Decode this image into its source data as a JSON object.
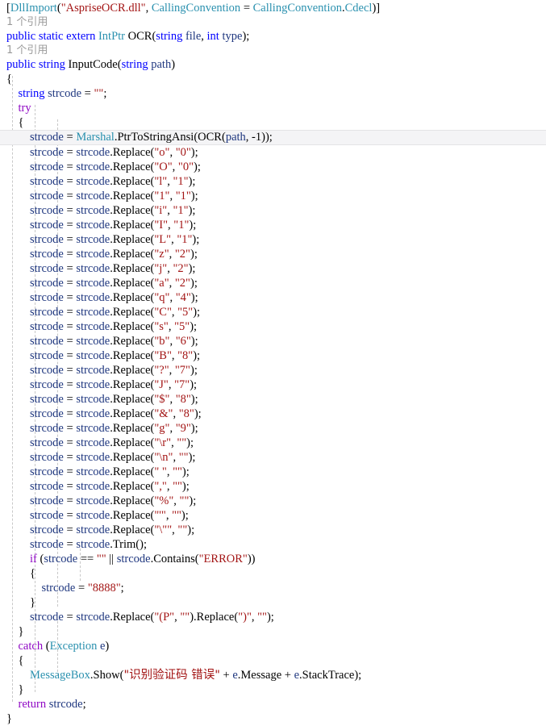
{
  "editor": {
    "language": "csharp",
    "background": "#ffffff",
    "current_line_background": "#f4f4f6",
    "colors": {
      "keyword": "#0000ff",
      "control_keyword": "#8f08c4",
      "type": "#2b91af",
      "string": "#a31515",
      "variable": "#1f377f",
      "plain": "#000000",
      "codelens": "#9a9a9a",
      "indent_guide": "#c8c8c8"
    },
    "codelens_label": "1 个引用",
    "lines": [
      {
        "id": "l1",
        "kind": "code",
        "text": "[DllImport(\"AspriseOCR.dll\", CallingConvention = CallingConvention.Cdecl)]"
      },
      {
        "id": "l2",
        "kind": "codelens",
        "text": "1 个引用"
      },
      {
        "id": "l3",
        "kind": "code",
        "text": "public static extern IntPtr OCR(string file, int type);"
      },
      {
        "id": "l4",
        "kind": "codelens",
        "text": "1 个引用"
      },
      {
        "id": "l5",
        "kind": "code",
        "text": "public string InputCode(string path)"
      },
      {
        "id": "l6",
        "kind": "code",
        "text": "{"
      },
      {
        "id": "l7",
        "kind": "code",
        "text": "    string strcode = \"\";"
      },
      {
        "id": "l8",
        "kind": "code",
        "text": "    try"
      },
      {
        "id": "l9",
        "kind": "code",
        "text": "    {"
      },
      {
        "id": "l10",
        "kind": "code",
        "current": true,
        "text": "        strcode = Marshal.PtrToStringAnsi(OCR(path, -1));"
      },
      {
        "id": "l11",
        "kind": "code",
        "text": "        strcode = strcode.Replace(\"o\", \"0\");"
      },
      {
        "id": "l12",
        "kind": "code",
        "text": "        strcode = strcode.Replace(\"O\", \"0\");"
      },
      {
        "id": "l13",
        "kind": "code",
        "text": "        strcode = strcode.Replace(\"l\", \"1\");"
      },
      {
        "id": "l14",
        "kind": "code",
        "text": "        strcode = strcode.Replace(\"1\", \"1\");"
      },
      {
        "id": "l15",
        "kind": "code",
        "text": "        strcode = strcode.Replace(\"i\", \"1\");"
      },
      {
        "id": "l16",
        "kind": "code",
        "text": "        strcode = strcode.Replace(\"I\", \"1\");"
      },
      {
        "id": "l17",
        "kind": "code",
        "text": "        strcode = strcode.Replace(\"L\", \"1\");"
      },
      {
        "id": "l18",
        "kind": "code",
        "text": "        strcode = strcode.Replace(\"z\", \"2\");"
      },
      {
        "id": "l19",
        "kind": "code",
        "text": "        strcode = strcode.Replace(\"j\", \"2\");"
      },
      {
        "id": "l20",
        "kind": "code",
        "text": "        strcode = strcode.Replace(\"a\", \"2\");"
      },
      {
        "id": "l21",
        "kind": "code",
        "text": "        strcode = strcode.Replace(\"q\", \"4\");"
      },
      {
        "id": "l22",
        "kind": "code",
        "text": "        strcode = strcode.Replace(\"C\", \"5\");"
      },
      {
        "id": "l23",
        "kind": "code",
        "text": "        strcode = strcode.Replace(\"s\", \"5\");"
      },
      {
        "id": "l24",
        "kind": "code",
        "text": "        strcode = strcode.Replace(\"b\", \"6\");"
      },
      {
        "id": "l25",
        "kind": "code",
        "text": "        strcode = strcode.Replace(\"B\", \"8\");"
      },
      {
        "id": "l26",
        "kind": "code",
        "text": "        strcode = strcode.Replace(\"?\", \"7\");"
      },
      {
        "id": "l27",
        "kind": "code",
        "text": "        strcode = strcode.Replace(\"J\", \"7\");"
      },
      {
        "id": "l28",
        "kind": "code",
        "text": "        strcode = strcode.Replace(\"$\", \"8\");"
      },
      {
        "id": "l29",
        "kind": "code",
        "text": "        strcode = strcode.Replace(\"&\", \"8\");"
      },
      {
        "id": "l30",
        "kind": "code",
        "text": "        strcode = strcode.Replace(\"g\", \"9\");"
      },
      {
        "id": "l31",
        "kind": "code",
        "text": "        strcode = strcode.Replace(\"\\r\", \"\");"
      },
      {
        "id": "l32",
        "kind": "code",
        "text": "        strcode = strcode.Replace(\"\\n\", \"\");"
      },
      {
        "id": "l33",
        "kind": "code",
        "text": "        strcode = strcode.Replace(\" \", \"\");"
      },
      {
        "id": "l34",
        "kind": "code",
        "text": "        strcode = strcode.Replace(\",\", \"\");"
      },
      {
        "id": "l35",
        "kind": "code",
        "text": "        strcode = strcode.Replace(\"%\", \"\");"
      },
      {
        "id": "l36",
        "kind": "code",
        "text": "        strcode = strcode.Replace(\"'\", \"\");"
      },
      {
        "id": "l37",
        "kind": "code",
        "text": "        strcode = strcode.Replace(\"\\\"\", \"\");"
      },
      {
        "id": "l38",
        "kind": "code",
        "text": "        strcode = strcode.Trim();"
      },
      {
        "id": "l39",
        "kind": "code",
        "text": "        if (strcode == \"\" || strcode.Contains(\"ERROR\"))"
      },
      {
        "id": "l40",
        "kind": "code",
        "text": "        {"
      },
      {
        "id": "l41",
        "kind": "code",
        "text": "            strcode = \"8888\";"
      },
      {
        "id": "l42",
        "kind": "code",
        "text": "        }"
      },
      {
        "id": "l43",
        "kind": "code",
        "text": "        strcode = strcode.Replace(\"(P\", \"\").Replace(\")\", \"\");"
      },
      {
        "id": "l44",
        "kind": "code",
        "text": "    }"
      },
      {
        "id": "l45",
        "kind": "code",
        "text": "    catch (Exception e)"
      },
      {
        "id": "l46",
        "kind": "code",
        "text": "    {"
      },
      {
        "id": "l47",
        "kind": "code",
        "text": "        MessageBox.Show(\"识别验证码 错误\" + e.Message + e.StackTrace);"
      },
      {
        "id": "l48",
        "kind": "code",
        "text": "    }"
      },
      {
        "id": "l49",
        "kind": "code",
        "text": "    return strcode;"
      },
      {
        "id": "l50",
        "kind": "code",
        "text": "}"
      }
    ]
  }
}
